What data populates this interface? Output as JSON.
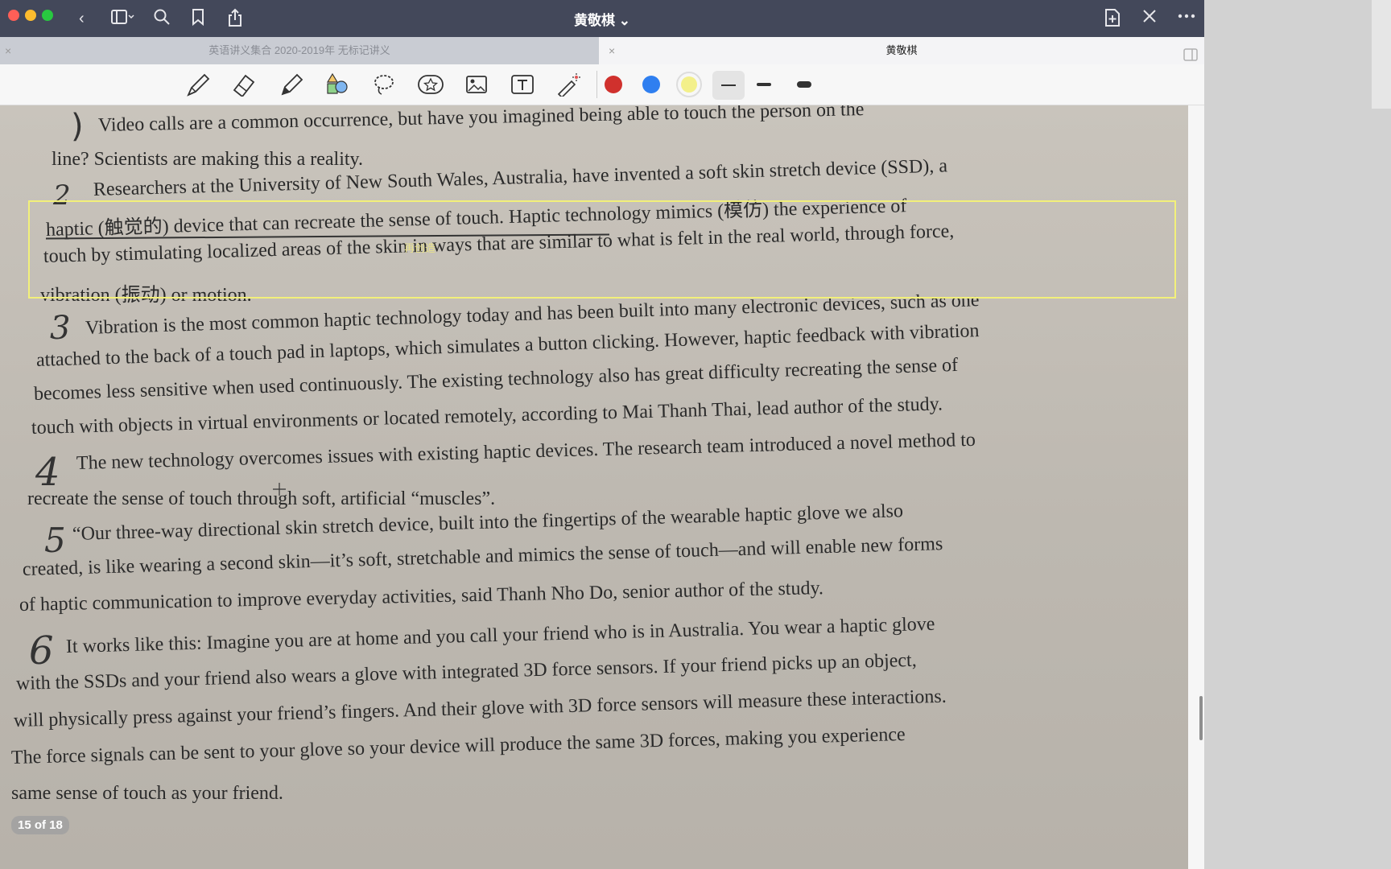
{
  "window": {
    "title": "黄敬棋 ⌄",
    "tabs": [
      {
        "label": "英语讲义集合 2020-2019年 无标记讲义",
        "close": "×"
      },
      {
        "label": "黄敬棋",
        "close": "×"
      }
    ]
  },
  "toolbar": {
    "tools": [
      "pen-icon",
      "eraser-icon",
      "highlighter-icon",
      "shapes-icon",
      "lasso-icon",
      "sticker-icon",
      "image-icon",
      "text-tool-icon",
      "laser-pointer-icon"
    ],
    "colors": [
      "#d0312d",
      "#2f7ff0",
      "#f3f08a"
    ],
    "strokes": [
      "thin",
      "medium",
      "thick"
    ]
  },
  "document": {
    "highlight_label": "再创造",
    "page_indicator": "15 of 18",
    "handwritten_numbers": [
      "2",
      "3",
      "4",
      "5",
      "6"
    ],
    "lines": [
      "Video calls are a common occurrence, but have you imagined being able to touch the person on the",
      "line? Scientists are making this a reality.",
      "Researchers at the University of New South Wales, Australia, have invented a soft skin stretch device (SSD), a",
      "haptic (触觉的) device that can recreate the sense of touch. Haptic technology mimics (模仿) the experience of",
      "touch by stimulating localized areas of the skin in ways that are similar to what is felt in the real world, through force,",
      "vibration (振动) or motion.",
      "Vibration is the most common haptic technology today and has been built into many electronic devices, such as one",
      "attached to the back of a touch pad in laptops, which simulates a button clicking. However, haptic feedback with vibration",
      "becomes less sensitive when used continuously. The existing technology also has great difficulty recreating the sense of",
      "touch with objects in virtual environments or located remotely, according to Mai Thanh Thai, lead author of the study.",
      "The new technology overcomes issues with existing haptic devices. The research team introduced a novel method to",
      "recreate the sense of touch through soft, artificial “muscles”.",
      "“Our three-way directional skin stretch device, built into the fingertips of the wearable haptic glove we also",
      "created, is like wearing a second skin—it’s soft, stretchable and mimics the sense of touch—and will enable new forms",
      "of haptic communication to improve everyday activities, said Thanh Nho Do, senior author of the study.",
      "It works like this: Imagine you are at home and you call your friend who is in Australia. You wear a haptic glove",
      "with the SSDs and your friend also wears a glove with integrated 3D force sensors. If your friend picks up an object,",
      "will physically press against your friend’s fingers. And their glove with 3D force sensors will measure these interactions.",
      "The force signals can be sent to your glove so your device will produce the same 3D forces, making you experience",
      "same sense of touch as your friend."
    ]
  }
}
